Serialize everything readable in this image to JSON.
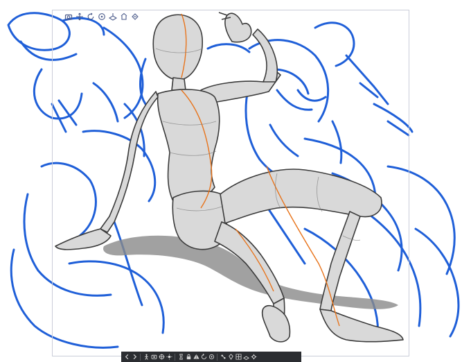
{
  "app": {
    "canvas": {
      "background": "#ffffff",
      "border_color": "#c9ccd8"
    },
    "sketch": {
      "stroke_color": "#1f5fd8"
    },
    "model": {
      "body_color": "#d9d9d9",
      "guide_line_color": "#e8731a",
      "shadow_color": "#8a8a8a"
    }
  },
  "object_toolbar": {
    "items": [
      {
        "icon": "camera-icon"
      },
      {
        "icon": "move-icon"
      },
      {
        "icon": "rotate-icon"
      },
      {
        "icon": "pan-icon"
      },
      {
        "icon": "plane-icon"
      },
      {
        "icon": "fit-icon"
      },
      {
        "icon": "reset-icon"
      }
    ]
  },
  "bottom_toolbar": {
    "background": "#2b2d31",
    "items": [
      {
        "icon": "chevron-left-icon"
      },
      {
        "icon": "chevron-right-icon"
      },
      {
        "icon": "pose-icon"
      },
      {
        "icon": "camera-view-icon"
      },
      {
        "icon": "snap-icon"
      },
      {
        "icon": "light-icon"
      },
      {
        "icon": "body-shape-icon"
      },
      {
        "icon": "lock-icon"
      },
      {
        "icon": "flip-icon"
      },
      {
        "icon": "undo-pose-icon"
      },
      {
        "icon": "reset-pose-icon"
      },
      {
        "icon": "joint-icon"
      },
      {
        "icon": "fixed-icon"
      },
      {
        "icon": "grid-icon"
      },
      {
        "icon": "ground-icon"
      },
      {
        "icon": "settings-icon"
      }
    ]
  }
}
